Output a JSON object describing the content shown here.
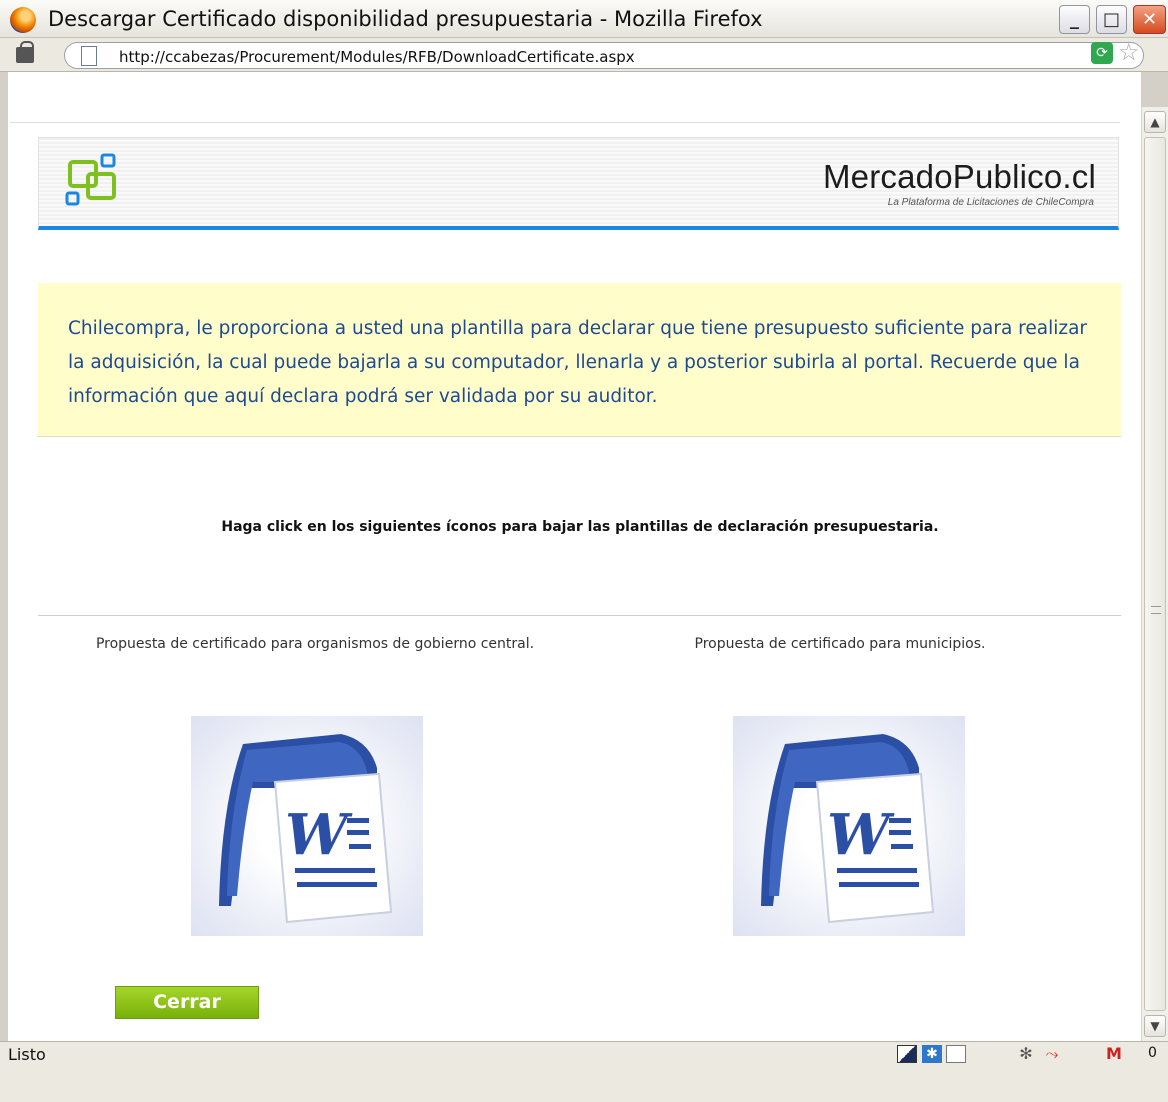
{
  "window": {
    "title": "Descargar Certificado disponibilidad presupuestaria - Mozilla Firefox",
    "min_label": "_",
    "max_label": "□",
    "close_label": "✕"
  },
  "navigation": {
    "url": "http://ccabezas/Procurement/Modules/RFB/DownloadCertificate.aspx"
  },
  "banner": {
    "brand_name": "MercadoPublico.cl",
    "tagline": "La Plataforma de Licitaciones de ChileCompra"
  },
  "info": {
    "text": "Chilecompra, le proporciona a usted una plantilla para declarar que tiene presupuesto suficiente para realizar la adquisición, la cual puede bajarla a su computador, llenarla y a posterior subirla al portal. Recuerde que la información que aquí declara podrá ser validada por su auditor."
  },
  "instruction": "Haga click en los siguientes íconos para bajar las plantillas de declaración presupuestaria.",
  "certificates": [
    {
      "label": "Propuesta de certificado para organismos de gobierno central.",
      "icon": "word-document-icon"
    },
    {
      "label": "Propuesta de certificado para municipios.",
      "icon": "word-document-icon"
    }
  ],
  "close_button": "Cerrar",
  "status": {
    "text": "Listo",
    "gmail_count": "0"
  },
  "colors": {
    "accent_blue": "#1a86e0",
    "info_bg": "#fffdc9",
    "info_text": "#1d4a92",
    "button_green": "#8cc51a"
  }
}
